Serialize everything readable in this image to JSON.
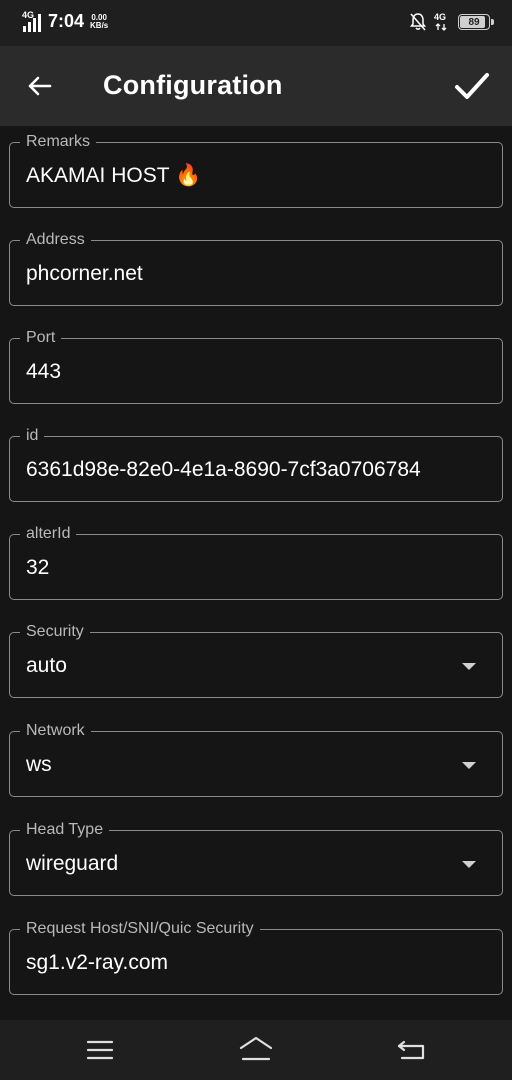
{
  "status": {
    "signal_label": "4G",
    "time": "7:04",
    "speed_value": "0.00",
    "speed_unit": "KB/s",
    "network_label": "4G",
    "battery": "89",
    "icons": [
      "signal-icon",
      "mute-bell-icon",
      "data-arrows-icon",
      "battery-icon"
    ]
  },
  "appbar": {
    "title": "Configuration",
    "back_icon": "arrow-left-icon",
    "save_icon": "check-icon"
  },
  "fields": {
    "remarks": {
      "label": "Remarks",
      "value": "AKAMAI HOST 🔥"
    },
    "address": {
      "label": "Address",
      "value": "phcorner.net"
    },
    "port": {
      "label": "Port",
      "value": "443"
    },
    "id": {
      "label": "id",
      "value": "6361d98e-82e0-4e1a-8690-7cf3a0706784"
    },
    "alterid": {
      "label": "alterId",
      "value": "32"
    },
    "security": {
      "label": "Security",
      "value": "auto"
    },
    "network": {
      "label": "Network",
      "value": "ws"
    },
    "headtype": {
      "label": "Head Type",
      "value": "wireguard"
    },
    "requesthost": {
      "label": "Request Host/SNI/Quic Security",
      "value": "sg1.v2-ray.com"
    }
  },
  "navbar": {
    "icons": [
      "menu-icon",
      "home-icon",
      "back-icon"
    ]
  },
  "colors": {
    "background": "#151515",
    "appbar": "#2b2b2b",
    "border": "#8a8a8a",
    "label": "#b9b9b9"
  }
}
